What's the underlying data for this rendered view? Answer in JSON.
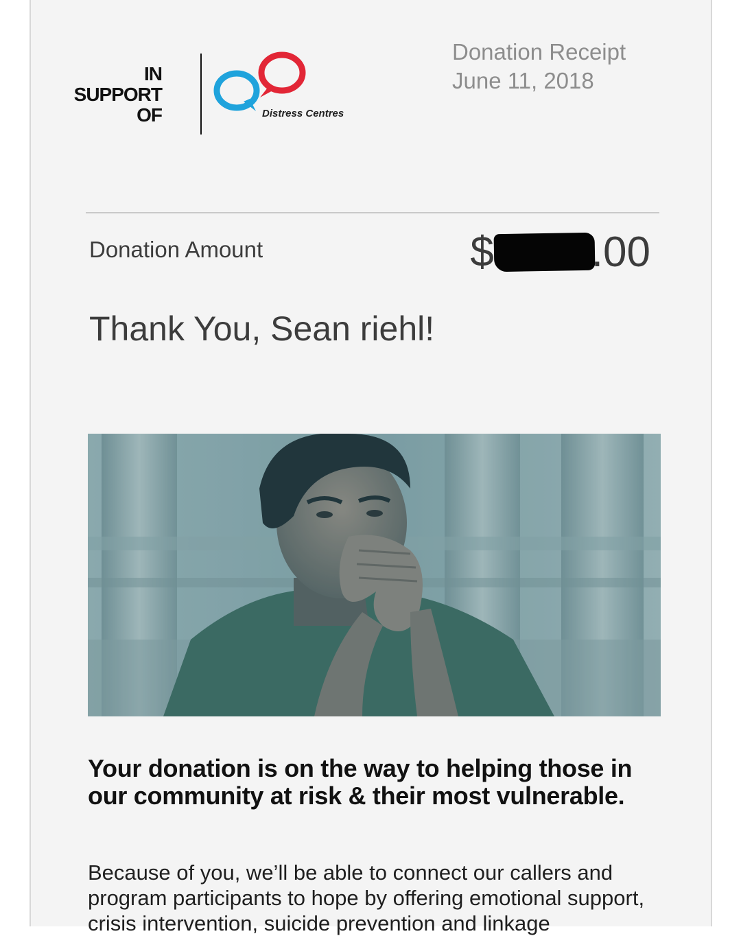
{
  "logo": {
    "support_line1": "IN",
    "support_line2": "SUPPORT",
    "support_line3": "OF",
    "org_name": "Distress Centres",
    "colors": {
      "blue": "#1fa3dc",
      "red": "#e22636"
    }
  },
  "receipt": {
    "title": "Donation Receipt",
    "date": "June 11, 2018"
  },
  "amount": {
    "label": "Donation Amount",
    "currency_symbol": "$",
    "cents": ".00",
    "redacted": true
  },
  "thank_you": "Thank You, Sean riehl!",
  "hero_image": {
    "description": "photo of a young man resting his chin on clasped hands in front of stone columns"
  },
  "headline": "Your donation is on the way to helping those in our community at risk & their most vulnerable.",
  "body": "Because of you, we’ll be able to connect our callers and program participants to hope by offering emotional support, crisis intervention, suicide prevention and linkage"
}
